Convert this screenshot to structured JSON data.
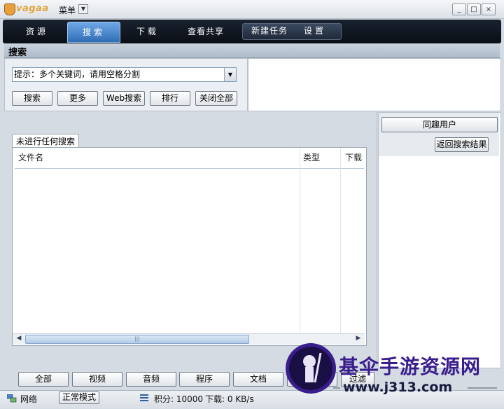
{
  "app": {
    "logo_text": "vagaa",
    "menu_label": "菜单"
  },
  "window_buttons": [
    "_",
    "□",
    "×"
  ],
  "nav": {
    "tabs": [
      {
        "label": "资源",
        "active": false
      },
      {
        "label": "搜索",
        "active": true
      },
      {
        "label": "下载",
        "active": false
      },
      {
        "label": "查看共享",
        "active": false
      }
    ],
    "right_items": [
      "新建任务",
      "设置"
    ]
  },
  "search": {
    "section_title": "搜索",
    "combo_value": "提示：多个关键词，请用空格分割",
    "buttons": [
      "搜索",
      "更多",
      "Web搜索",
      "排行",
      "关闭全部"
    ]
  },
  "results": {
    "tab_label": "未进行任何搜索",
    "columns": [
      "文件名",
      "类型",
      "下载"
    ],
    "scroll_thumb": "|||"
  },
  "right_panel": {
    "top_button": "同趣用户",
    "back_button": "返回搜索结果"
  },
  "filters": [
    "全部",
    "视频",
    "音频",
    "程序",
    "文档",
    "",
    "过滤"
  ],
  "status": {
    "network": "网络",
    "mode": "正常模式",
    "points": "积分: 10000",
    "download_speed": "下载: 0 KB/s"
  },
  "watermark": {
    "title": "基伞手游资源网",
    "url": "www.j313.com"
  },
  "colors": {
    "nav_bg": "#0f1520",
    "nav_active": "#3f80c8",
    "watermark_purple": "#3a1d8c"
  },
  "icons": [
    "vagaa-logo-icon",
    "dropdown-arrow-icon",
    "minimize-icon",
    "maximize-icon",
    "close-icon",
    "network-icon",
    "speed-bars-icon"
  ]
}
